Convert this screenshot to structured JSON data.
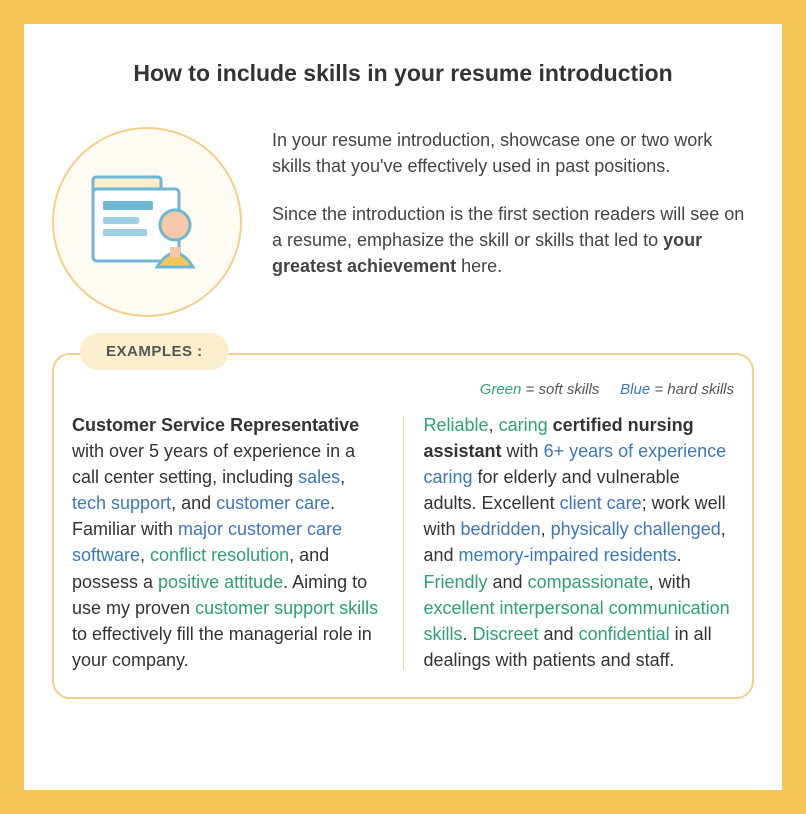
{
  "title": "How to include skills in your resume introduction",
  "intro": {
    "p1": "In your resume introduction, showcase one or two work skills that you've effectively used in past positions.",
    "p2_a": "Since the introduction is the first section readers will see on a resume, emphasize the skill or skills that led to ",
    "p2_bold": "your greatest achievement",
    "p2_b": " here."
  },
  "examples_label": "EXAMPLES :",
  "legend": {
    "green": "Green",
    "green_eq": " = soft skills",
    "blue": "Blue",
    "blue_eq": " = hard skills"
  },
  "left": {
    "t1_bold": "Customer Service Representative",
    "t2": " with over 5 years of experience in a call center setting, including ",
    "s_sales": "sales",
    "t3": ", ",
    "s_tech": "tech support",
    "t4": ", and ",
    "s_custcare": "customer care",
    "t5": ". Familiar with ",
    "s_software": "major customer care software",
    "t6": ", ",
    "s_conflict": "conflict resolution",
    "t7": ", and possess a ",
    "s_positive": "positive attitude",
    "t8": ". Aiming to use my proven ",
    "s_support": "customer support skills",
    "t9": " to effectively fill the managerial role in your company."
  },
  "right": {
    "s_reliable": "Reliable",
    "t1": ", ",
    "s_caring": "caring",
    "t2": " ",
    "bold_cna": "certified nursing assistant",
    "t3": " with ",
    "s_years": "6+ years of experience caring",
    "t4": " for elderly and vulnerable adults. Excellent ",
    "s_clientcare": "client care",
    "t5": "; work well with ",
    "s_bedridden": "bedridden",
    "t6": ", ",
    "s_phys": "physically challenged",
    "t7": ", and ",
    "s_memory": "memory-impaired residents",
    "t8": ". ",
    "s_friendly": "Friendly",
    "t9": " and ",
    "s_compassionate": "compassionate",
    "t10": ", with ",
    "s_comm": "excellent interpersonal communication skills",
    "t11": ". ",
    "s_discreet": "Discreet",
    "t12": " and ",
    "s_confidential": "confidential",
    "t13": " in all dealings with patients and staff."
  }
}
